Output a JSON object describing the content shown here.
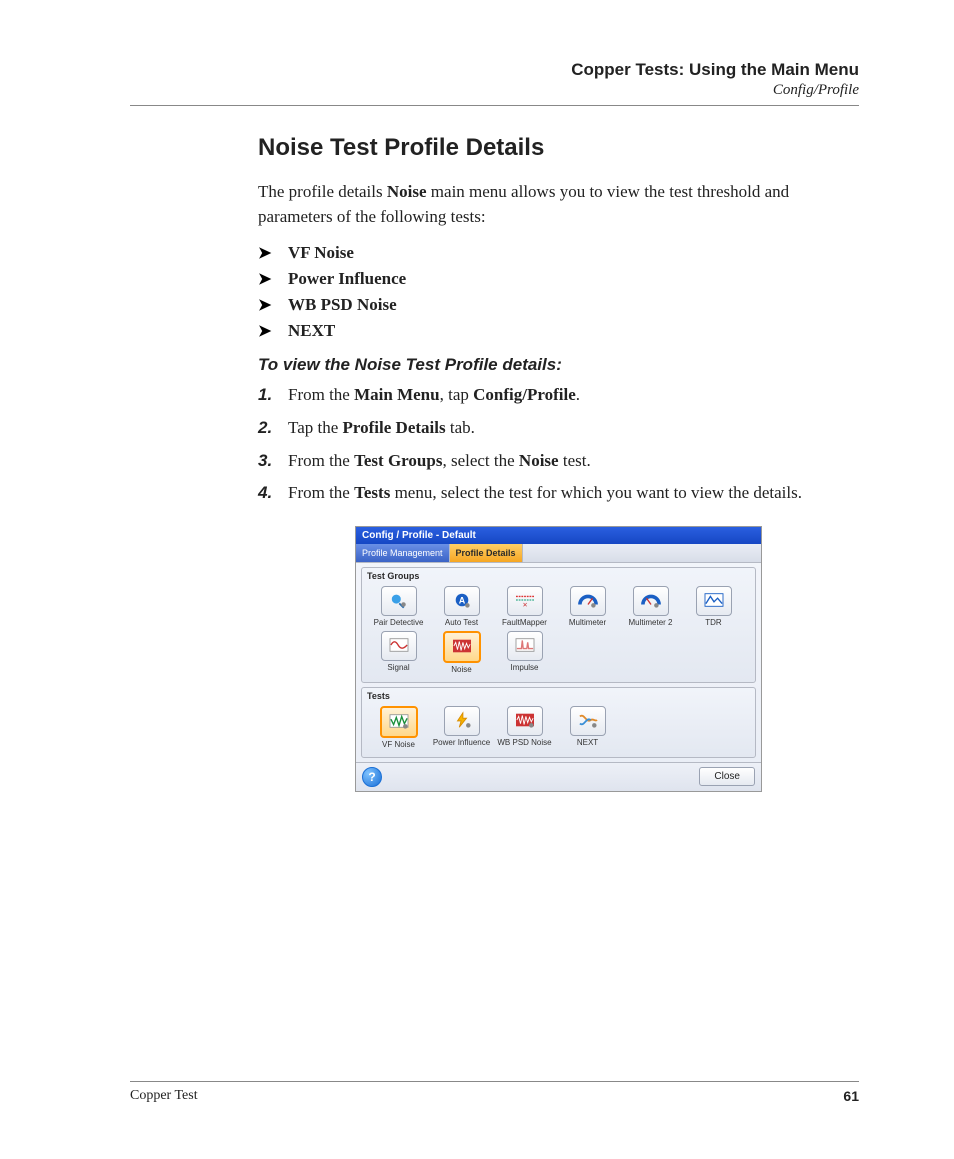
{
  "header": {
    "chapter": "Copper Tests: Using the Main Menu",
    "section": "Config/Profile"
  },
  "title": "Noise Test Profile Details",
  "intro_parts": {
    "p1": "The profile details ",
    "b1": "Noise",
    "p2": " main menu allows you to view the test threshold and parameters of the following tests:"
  },
  "bullets": [
    "VF Noise",
    "Power Influence",
    "WB PSD Noise",
    "NEXT"
  ],
  "procedure_title": "To view the Noise Test Profile details:",
  "steps": [
    {
      "pre": "From the ",
      "b1": "Main Menu",
      "mid": ", tap ",
      "b2": "Config/Profile",
      "post": "."
    },
    {
      "pre": "Tap the ",
      "b1": "Profile Details",
      "mid": " tab.",
      "b2": "",
      "post": ""
    },
    {
      "pre": "From the ",
      "b1": "Test Groups",
      "mid": ", select the ",
      "b2": "Noise",
      "post": " test."
    },
    {
      "pre": "From the ",
      "b1": "Tests",
      "mid": " menu, select the test for which you want to view the details.",
      "b2": "",
      "post": ""
    }
  ],
  "screenshot": {
    "titlebar": "Config / Profile - Default",
    "tabs": {
      "inactive": "Profile Management",
      "active": "Profile Details"
    },
    "groups": {
      "test_groups": {
        "label": "Test Groups",
        "items": [
          {
            "name": "Pair Detective",
            "icon": "pair-detective"
          },
          {
            "name": "Auto Test",
            "icon": "auto-test"
          },
          {
            "name": "FaultMapper",
            "icon": "fault-mapper"
          },
          {
            "name": "Multimeter",
            "icon": "multimeter"
          },
          {
            "name": "Multimeter 2",
            "icon": "multimeter2"
          },
          {
            "name": "TDR",
            "icon": "tdr"
          },
          {
            "name": "Signal",
            "icon": "signal"
          },
          {
            "name": "Noise",
            "icon": "noise",
            "selected": true
          },
          {
            "name": "Impulse",
            "icon": "impulse"
          }
        ]
      },
      "tests": {
        "label": "Tests",
        "items": [
          {
            "name": "VF Noise",
            "icon": "vf-noise",
            "selected": true
          },
          {
            "name": "Power Influence",
            "icon": "power-influence"
          },
          {
            "name": "WB PSD Noise",
            "icon": "wb-psd-noise"
          },
          {
            "name": "NEXT",
            "icon": "next"
          }
        ]
      }
    },
    "help": "?",
    "close": "Close"
  },
  "footer": {
    "doc": "Copper Test",
    "page": "61"
  }
}
